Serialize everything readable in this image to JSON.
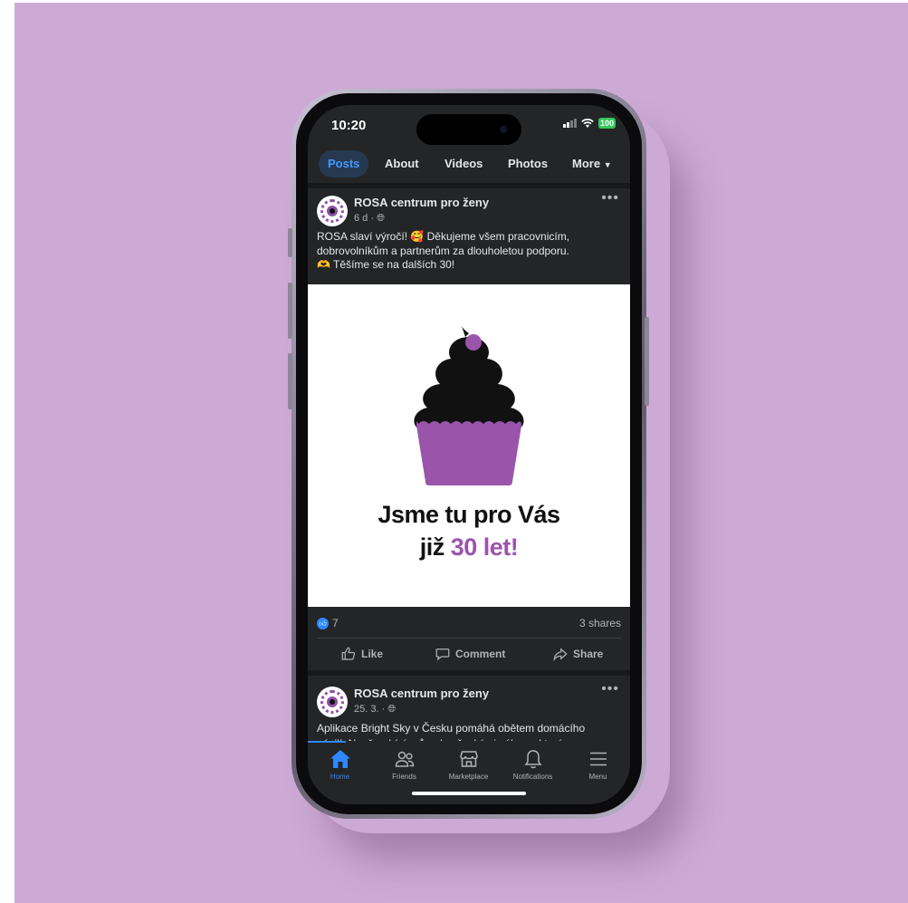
{
  "status_bar": {
    "time": "10:20",
    "battery": "100"
  },
  "tabs": [
    {
      "label": "Posts",
      "active": true
    },
    {
      "label": "About",
      "active": false
    },
    {
      "label": "Videos",
      "active": false
    },
    {
      "label": "Photos",
      "active": false
    },
    {
      "label": "More",
      "active": false
    }
  ],
  "post1": {
    "author": "ROSA centrum pro ženy",
    "meta": "6 d ·",
    "text_line1": "ROSA slaví výročí! 🥰 Děkujeme všem pracovnicím,",
    "text_line2": "dobrovolníkům a partnerům za dlouholetou podporu.",
    "text_line3": "🫶 Těšíme se na dalších 30!",
    "image": {
      "headline_line1": "Jsme tu pro Vás",
      "headline_line2_prefix": "již ",
      "headline_line2_accent": "30 let!"
    },
    "like_count": "7",
    "shares": "3 shares"
  },
  "actions": {
    "like": "Like",
    "comment": "Comment",
    "share": "Share"
  },
  "post2": {
    "author": "ROSA centrum pro ženy",
    "meta": "25. 3. ·",
    "text_line1": "Aplikace Bright Sky v Česku pomáhá obětem domácího",
    "text_line2": "násilí. Nově nabízí průvodce českými zákony, které"
  },
  "bottom_nav": [
    {
      "label": "Home",
      "icon": "home-icon",
      "active": true
    },
    {
      "label": "Friends",
      "icon": "friends-icon",
      "active": false
    },
    {
      "label": "Marketplace",
      "icon": "marketplace-icon",
      "active": false
    },
    {
      "label": "Notifications",
      "icon": "bell-icon",
      "active": false
    },
    {
      "label": "Menu",
      "icon": "menu-icon",
      "active": false
    }
  ],
  "colors": {
    "background": "#cdaad5",
    "accent_purple": "#9a55ab",
    "facebook_blue": "#2d88ff",
    "screen_dark": "#242526"
  }
}
